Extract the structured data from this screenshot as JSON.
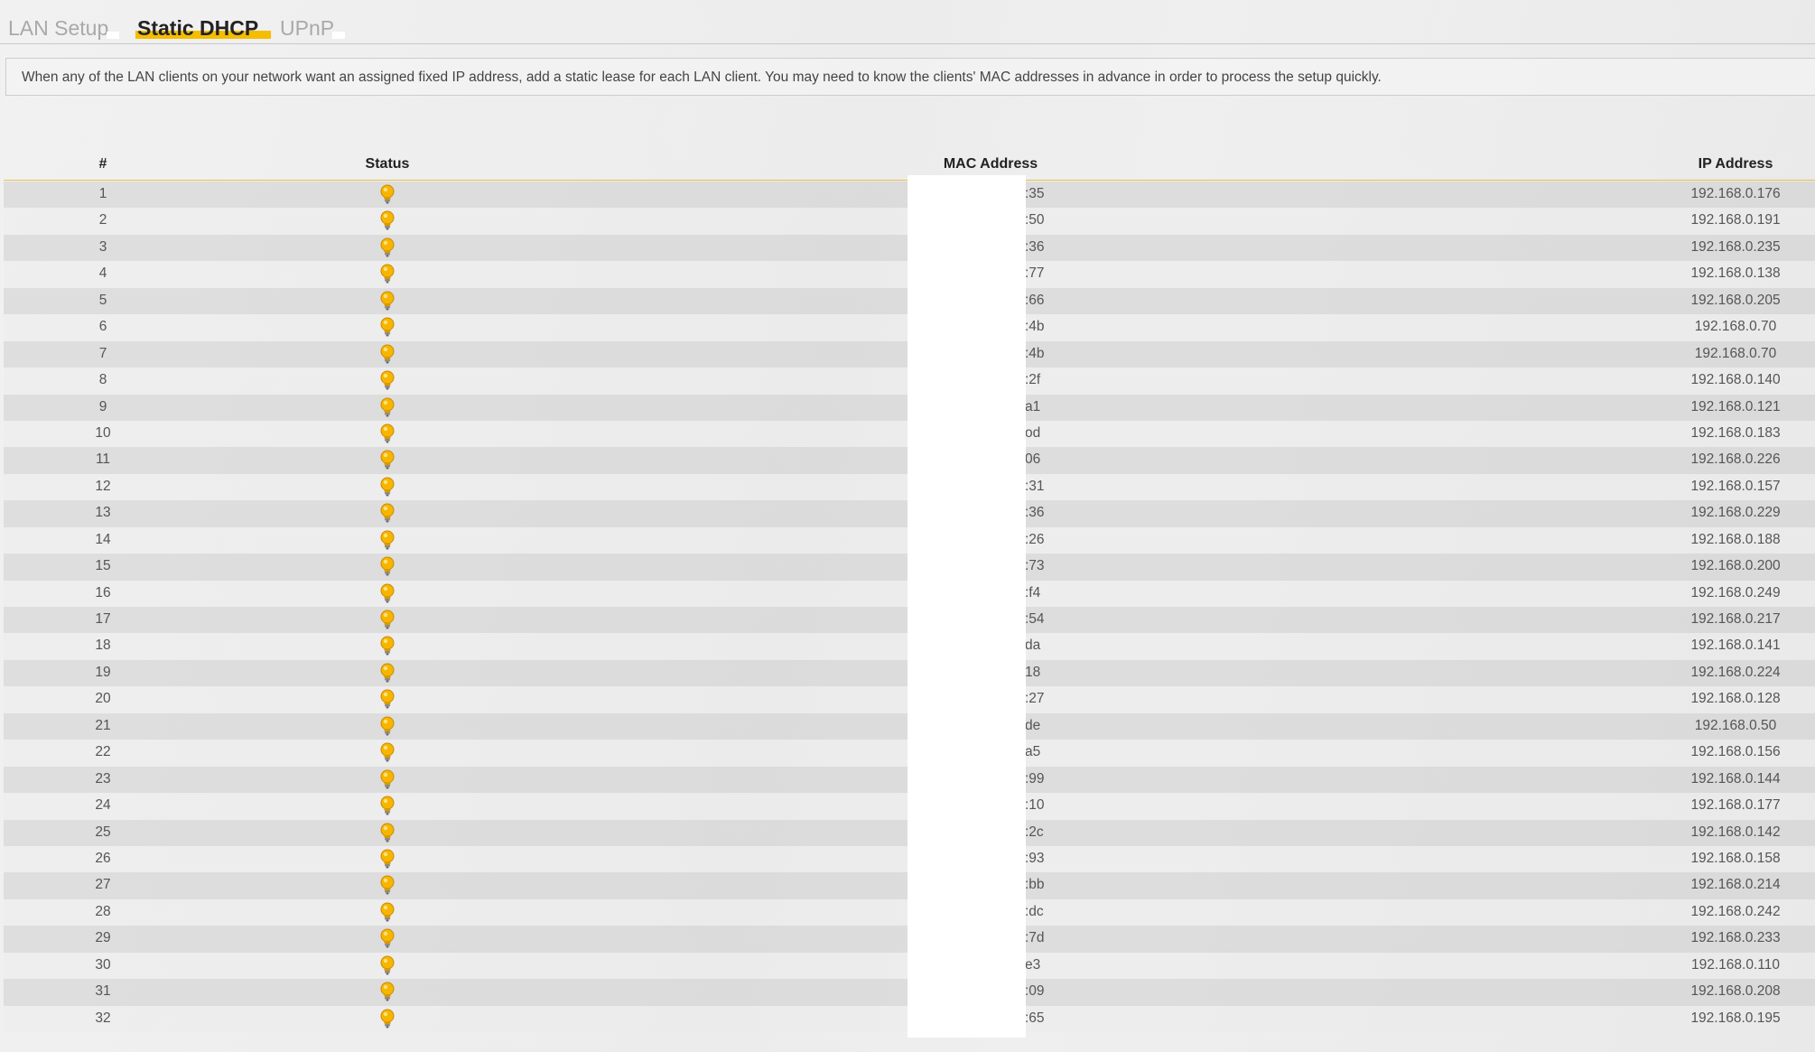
{
  "tabs": [
    {
      "label": "LAN Setup",
      "active": false
    },
    {
      "label": "Static DHCP",
      "active": true
    },
    {
      "label": "UPnP",
      "active": false
    }
  ],
  "notice": "When any of the LAN clients on your network want an assigned fixed IP address, add a static lease for each LAN client. You may need to know the clients' MAC addresses in advance in order to process the setup quickly.",
  "table": {
    "headers": {
      "num": "#",
      "status": "Status",
      "mac": "MAC Address",
      "ip": "IP Address"
    },
    "rows": [
      {
        "num": "1",
        "mac": ":35",
        "ip": "192.168.0.176"
      },
      {
        "num": "2",
        "mac": ":50",
        "ip": "192.168.0.191"
      },
      {
        "num": "3",
        "mac": ":36",
        "ip": "192.168.0.235"
      },
      {
        "num": "4",
        "mac": ":77",
        "ip": "192.168.0.138"
      },
      {
        "num": "5",
        "mac": ":66",
        "ip": "192.168.0.205"
      },
      {
        "num": "6",
        "mac": ":4b",
        "ip": "192.168.0.70"
      },
      {
        "num": "7",
        "mac": ":4b",
        "ip": "192.168.0.70"
      },
      {
        "num": "8",
        "mac": ":2f",
        "ip": "192.168.0.140"
      },
      {
        "num": "9",
        "mac": "a1",
        "ip": "192.168.0.121"
      },
      {
        "num": "10",
        "mac": "od",
        "ip": "192.168.0.183"
      },
      {
        "num": "11",
        "mac": "06",
        "ip": "192.168.0.226"
      },
      {
        "num": "12",
        "mac": ":31",
        "ip": "192.168.0.157"
      },
      {
        "num": "13",
        "mac": ":36",
        "ip": "192.168.0.229"
      },
      {
        "num": "14",
        "mac": ":26",
        "ip": "192.168.0.188"
      },
      {
        "num": "15",
        "mac": ":73",
        "ip": "192.168.0.200"
      },
      {
        "num": "16",
        "mac": ":f4",
        "ip": "192.168.0.249"
      },
      {
        "num": "17",
        "mac": ":54",
        "ip": "192.168.0.217"
      },
      {
        "num": "18",
        "mac": "da",
        "ip": "192.168.0.141"
      },
      {
        "num": "19",
        "mac": "18",
        "ip": "192.168.0.224"
      },
      {
        "num": "20",
        "mac": ":27",
        "ip": "192.168.0.128"
      },
      {
        "num": "21",
        "mac": "de",
        "ip": "192.168.0.50"
      },
      {
        "num": "22",
        "mac": "a5",
        "ip": "192.168.0.156"
      },
      {
        "num": "23",
        "mac": ":99",
        "ip": "192.168.0.144"
      },
      {
        "num": "24",
        "mac": ":10",
        "ip": "192.168.0.177"
      },
      {
        "num": "25",
        "mac": ":2c",
        "ip": "192.168.0.142"
      },
      {
        "num": "26",
        "mac": ":93",
        "ip": "192.168.0.158"
      },
      {
        "num": "27",
        "mac": ":bb",
        "ip": "192.168.0.214"
      },
      {
        "num": "28",
        "mac": ":dc",
        "ip": "192.168.0.242"
      },
      {
        "num": "29",
        "mac": ":7d",
        "ip": "192.168.0.233"
      },
      {
        "num": "30",
        "mac": "e3",
        "ip": "192.168.0.110"
      },
      {
        "num": "31",
        "mac": ":09",
        "ip": "192.168.0.208"
      },
      {
        "num": "32",
        "mac": ":65",
        "ip": "192.168.0.195"
      }
    ]
  },
  "icons": {
    "status": "lightbulb-icon"
  },
  "colors": {
    "accent": "#f5bd00",
    "bulb": "#f7b500",
    "header_line": "#e8c24a"
  }
}
